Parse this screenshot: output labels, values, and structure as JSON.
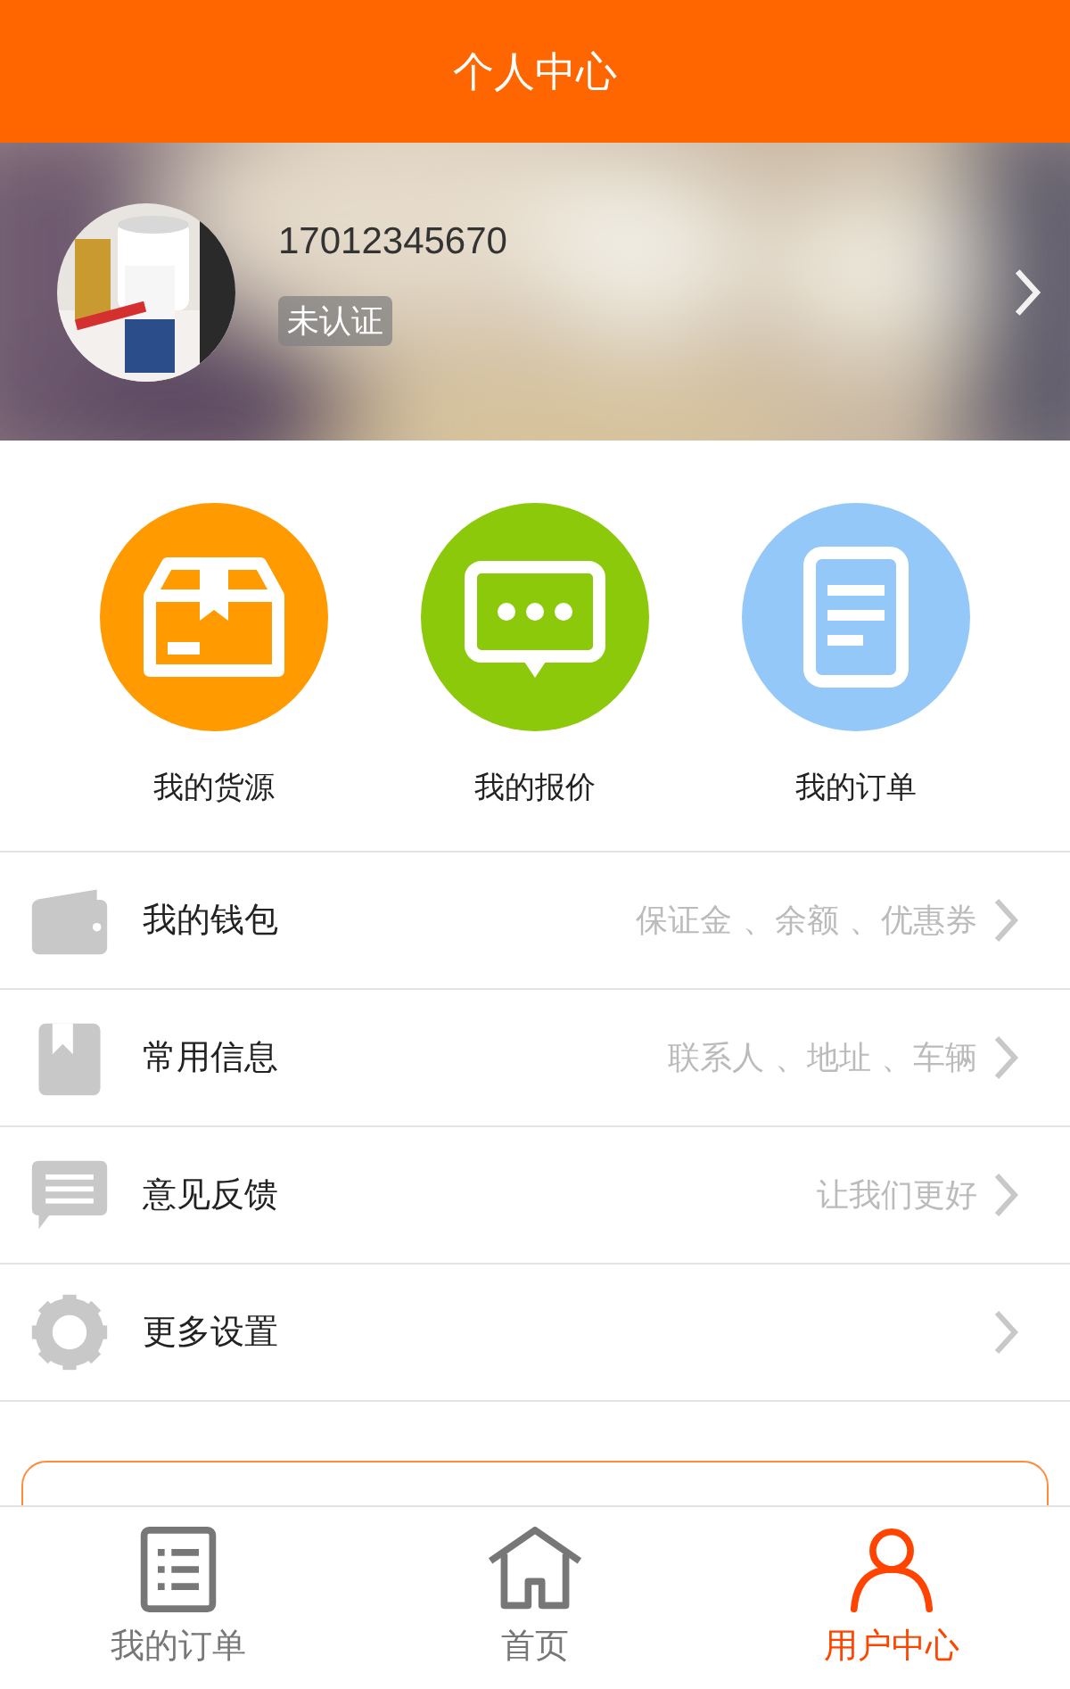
{
  "header": {
    "title": "个人中心"
  },
  "profile": {
    "phone": "17012345670",
    "badge": "未认证"
  },
  "actions": [
    {
      "label": "我的货源",
      "kind": "box",
      "color": "#ff9a00"
    },
    {
      "label": "我的报价",
      "kind": "chat",
      "color": "#8cc90a"
    },
    {
      "label": "我的订单",
      "kind": "doc",
      "color": "#94c8f8"
    }
  ],
  "menu": [
    {
      "label": "我的钱包",
      "hint": "保证金 、余额 、优惠券",
      "kind": "wallet"
    },
    {
      "label": "常用信息",
      "hint": "联系人 、地址 、车辆",
      "kind": "bookmark"
    },
    {
      "label": "意见反馈",
      "hint": "让我们更好",
      "kind": "message"
    },
    {
      "label": "更多设置",
      "kind": "gear"
    }
  ],
  "tabs": [
    {
      "label": "我的订单",
      "kind": "list",
      "selected": false
    },
    {
      "label": "首页",
      "kind": "home",
      "selected": false
    },
    {
      "label": "用户中心",
      "kind": "person",
      "selected": true
    }
  ]
}
